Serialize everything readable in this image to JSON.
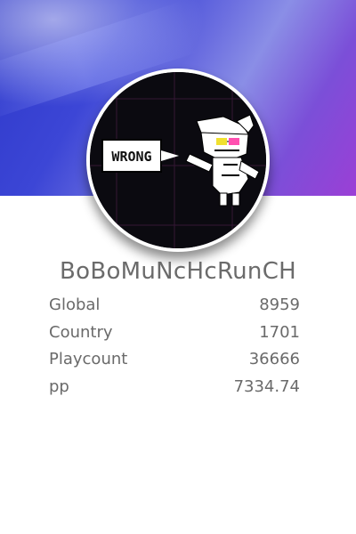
{
  "profile": {
    "username": "BoBoMuNcHcRunCH",
    "avatar_speech_text": "WRONG",
    "banner_colors": [
      "#2d38c9",
      "#8a8ee6",
      "#9b3fd6"
    ],
    "stats": [
      {
        "label": "Global",
        "value": "8959"
      },
      {
        "label": "Country",
        "value": "1701"
      },
      {
        "label": "Playcount",
        "value": "36666"
      },
      {
        "label": "pp",
        "value": "7334.74"
      }
    ]
  }
}
